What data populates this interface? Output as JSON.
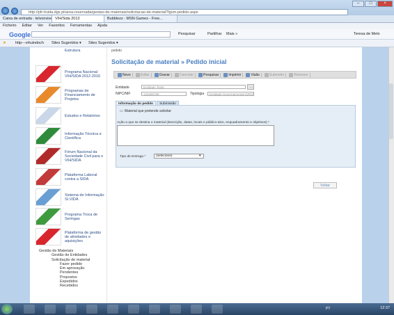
{
  "browser": {
    "url": "http://pfr-hvida.dgs.pt/area-reservada/gestao-de-materiais/solicitacao-de-material?fgsm-pedido.aspx",
    "tabs": [
      "Caixa de entrada - telvonviveis...",
      "VIH/Sida 2013",
      "Bubblezz - MSN Games - Free..."
    ],
    "window_controls": [
      "–",
      "□",
      "×"
    ],
    "menu": [
      "Ficheiro",
      "Editar",
      "Ver",
      "Favoritos",
      "Ferramentas",
      "Ajuda"
    ],
    "google_bar": {
      "logo": "Google",
      "search_label": "Pesquisar",
      "share_label": "Partilhar",
      "more_label": "Mais »",
      "user": "Teresa de Melo"
    },
    "favorites": [
      "http---vihuindoch",
      "Sites Sugeridos ▾",
      "Sites Sugeridos ▾"
    ]
  },
  "sidebar": {
    "partial_top": "Estrutura",
    "items": [
      {
        "label": "Programa Nacional VIH/SIDA 2012-2016",
        "img_color": "#d8262e"
      },
      {
        "label": "Programas de Financiamento de Projetos",
        "img_color": "#e88a2c"
      },
      {
        "label": "Estudos e Relatórios",
        "img_color": "#c9d7e8"
      },
      {
        "label": "Informação Técnica e Científica",
        "img_color": "#2f8a3b"
      },
      {
        "label": "Fórum Nacional da Sociedade Civil para o VIH/SIDA",
        "img_color": "#b02a2a"
      },
      {
        "label": "Plataforma Laboral contra a SIDA",
        "img_color": "#c23a3a"
      },
      {
        "label": "Sistema de Informação SI.VIDA",
        "img_color": "#6a9fd4"
      },
      {
        "label": "Programa Troca de Seringas",
        "img_color": "#3e9a3e"
      },
      {
        "label": "Plataforma de gestão de atividades e aquisições",
        "img_color": "#d8262e"
      }
    ],
    "tree": [
      "Gestão de Materiais",
      "Gestão de Entidades",
      "Solicitação de material",
      "Fazer pedido",
      "Em aprovação",
      "Pendentes",
      "Propostos",
      "Expedidos",
      "Recebidos"
    ]
  },
  "main": {
    "crumb": "pedido",
    "title": "Solicitação de material » Pedido inicial",
    "toolbar": [
      {
        "label": "Novo",
        "enabled": true
      },
      {
        "label": "Editar",
        "enabled": false
      },
      {
        "label": "Gravar",
        "enabled": true
      },
      {
        "label": "Cancelar",
        "enabled": false
      },
      {
        "label": "Pesquisar",
        "enabled": true
      },
      {
        "label": "Imprimir",
        "enabled": true
      },
      {
        "label": "Visão",
        "enabled": true
      },
      {
        "label": "Submeter",
        "enabled": false
      },
      {
        "label": "Remover",
        "enabled": false
      }
    ],
    "entity_label": "Entidade",
    "entity_placeholder": "Entidade Teste",
    "nipc_label": "NIPC/NIF",
    "nipc_value": "123456789",
    "tipologia_label": "Tipologia",
    "tipologia_value": "Entidade Governamental (DRS)",
    "lookup_btn": "...",
    "tabs": [
      "Informação do pedido",
      "Submissão"
    ],
    "material_link": "Material que pretende solicitar",
    "action_label": "Ação a que se destina o material (descrição, datas, locais e público-alvo, enquadramento e objetivos) *",
    "delivery_label": "Tipo de Entrega *",
    "delivery_value": "(selecione)",
    "back_button": "Voltar"
  },
  "taskbar": {
    "lang": "PT",
    "time": "12:37"
  }
}
